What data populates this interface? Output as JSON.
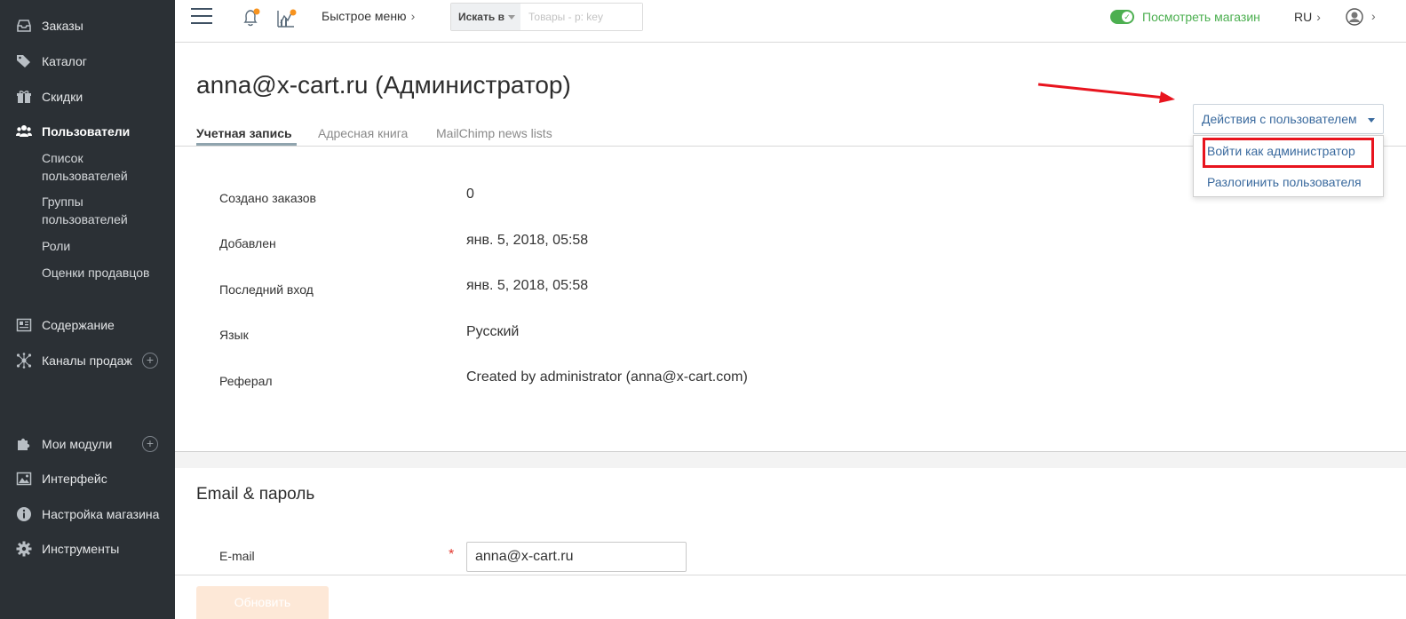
{
  "sidebar": {
    "items": [
      {
        "label": "Заказы",
        "icon": "inbox-icon"
      },
      {
        "label": "Каталог",
        "icon": "tags-icon"
      },
      {
        "label": "Скидки",
        "icon": "gift-icon"
      },
      {
        "label": "Пользователи",
        "icon": "users-icon",
        "active": true
      },
      {
        "label": "Содержание",
        "icon": "newspaper-icon"
      },
      {
        "label": "Каналы продаж",
        "icon": "network-icon"
      },
      {
        "label": "Мои модули",
        "icon": "puzzle-icon"
      },
      {
        "label": "Интерфейс",
        "icon": "image-icon"
      },
      {
        "label": "Настройка магазина",
        "icon": "info-icon"
      },
      {
        "label": "Инструменты",
        "icon": "gear-icon"
      }
    ],
    "sub_items": [
      "Список пользователей",
      "Группы пользователей",
      "Роли",
      "Оценки продавцов"
    ],
    "plus_symbol": "+"
  },
  "topbar": {
    "quick_menu": "Быстрое меню",
    "search_in": "Искать в",
    "search_placeholder": "Товары - р: key",
    "view_store": "Посмотреть магазин",
    "lang": "RU",
    "chevron": "›",
    "check": "✓"
  },
  "page": {
    "title": "anna@x-cart.ru (Администратор)",
    "tabs": [
      "Учетная запись",
      "Адресная книга",
      "MailChimp news lists"
    ]
  },
  "actions": {
    "button_label": "Действия с пользователем",
    "menu": [
      "Войти как администратор",
      "Разлогинить пользователя"
    ]
  },
  "info": [
    {
      "label": "Создано заказов",
      "value": "0"
    },
    {
      "label": "Добавлен",
      "value": "янв. 5, 2018, 05:58"
    },
    {
      "label": "Последний вход",
      "value": "янв. 5, 2018, 05:58"
    },
    {
      "label": "Язык",
      "value": "Русский"
    },
    {
      "label": "Реферал",
      "value": "Created by administrator (anna@x-cart.com)"
    }
  ],
  "email_section": {
    "title": "Email & пароль",
    "email_label": "E-mail",
    "required_mark": "*",
    "email_value": "anna@x-cart.ru"
  },
  "footer": {
    "update_label": "Обновить"
  },
  "colors": {
    "sidebar_bg": "#2b3035",
    "accent_green": "#4caf50",
    "link_blue": "#3a6a9e",
    "highlight_red": "#e8141e",
    "notification_orange": "#f7931e"
  }
}
